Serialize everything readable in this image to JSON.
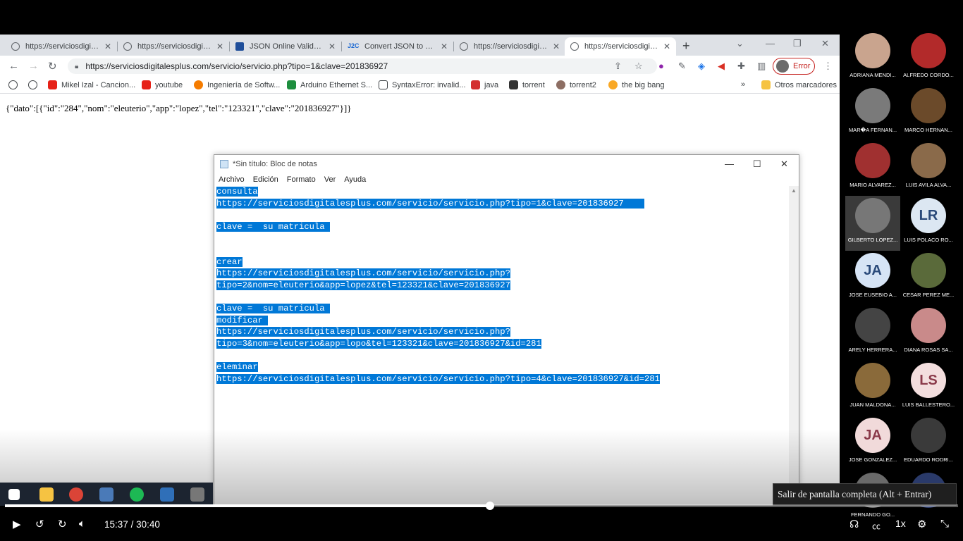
{
  "browser": {
    "tabs": [
      {
        "label": "https://serviciosdigitales",
        "icon": "globe-icon"
      },
      {
        "label": "https://serviciosdigitales",
        "icon": "globe-icon"
      },
      {
        "label": "JSON Online Validator",
        "icon": "jsonlint-icon"
      },
      {
        "label": "Convert JSON to C# Classes",
        "icon": "j2c-icon"
      },
      {
        "label": "https://serviciosdigitales",
        "icon": "globe-icon"
      },
      {
        "label": "https://serviciosdigitales",
        "icon": "globe-icon"
      }
    ],
    "url": "https://serviciosdigitalesplus.com/servicio/servicio.php?tipo=1&clave=201836927",
    "error_label": "Error",
    "bookmarks": [
      "Mikel Izal - Cancion...",
      "youtube",
      "Ingeniería de Softw...",
      "Arduino Ethernet S...",
      "SyntaxError: invalid...",
      "java",
      "torrent",
      "torrent2",
      "the big bang"
    ],
    "other_bookmarks": "Otros marcadores",
    "page_json": "{\"dato\":[{\"id\":\"284\",\"nom\":\"eleuterio\",\"app\":\"lopez\",\"tel\":\"123321\",\"clave\":\"201836927\"}]}"
  },
  "notepad": {
    "title": "*Sin título: Bloc de notas",
    "menu": [
      "Archivo",
      "Edición",
      "Formato",
      "Ver",
      "Ayuda"
    ],
    "lines": [
      "consulta",
      "https://serviciosdigitalesplus.com/servicio/servicio.php?tipo=1&clave=201836927    ",
      "",
      "clave =  su matricula ",
      "",
      "",
      "crear",
      "https://serviciosdigitalesplus.com/servicio/servicio.php?",
      "tipo=2&nom=eleuterio&app=lopez&tel=123321&clave=201836927",
      "",
      "clave =  su matricula ",
      "modificar ",
      "https://serviciosdigitalesplus.com/servicio/servicio.php?",
      "tipo=3&nom=eleuterio&app=lopo&tel=123321&clave=201836927&id=281",
      "",
      "eleminar",
      "https://serviciosdigitalesplus.com/servicio/servicio.php?tipo=4&clave=201836927&id=281"
    ]
  },
  "participants": [
    {
      "name": "ADRIANA MENDI...",
      "initials": "",
      "color": "#c9a48e"
    },
    {
      "name": "ALFREDO CORDO...",
      "initials": "",
      "color": "#b22a2a"
    },
    {
      "name": "MAR�A FERNAN...",
      "initials": "",
      "color": "#7a7a7a"
    },
    {
      "name": "MARCO HERNAN...",
      "initials": "",
      "color": "#6b4a2a"
    },
    {
      "name": "MARIO ALVAREZ...",
      "initials": "",
      "color": "#a03030"
    },
    {
      "name": "LUIS AVILA ALVA...",
      "initials": "",
      "color": "#8a6a4a"
    },
    {
      "name": "GILBERTO LOPEZ...",
      "initials": "",
      "color": "#777777"
    },
    {
      "name": "LUIS POLACO RO...",
      "initials": "LR",
      "color": "#dce7f2"
    },
    {
      "name": "JOSE EUSEBIO A...",
      "initials": "JA",
      "color": "#d6e4f5"
    },
    {
      "name": "CESAR PEREZ ME...",
      "initials": "",
      "color": "#5a6a3a"
    },
    {
      "name": "ARELY HERRERA...",
      "initials": "",
      "color": "#444444"
    },
    {
      "name": "DIANA ROSAS SA...",
      "initials": "",
      "color": "#c98a8a"
    },
    {
      "name": "JUAN MALDONA...",
      "initials": "",
      "color": "#8a6a3a"
    },
    {
      "name": "LUIS BALLESTERO...",
      "initials": "LS",
      "color": "#f3dede"
    },
    {
      "name": "JOSE GONZALEZ...",
      "initials": "JA",
      "color": "#f1dada"
    },
    {
      "name": "EDUARDO RODRI...",
      "initials": "",
      "color": "#3a3a3a"
    },
    {
      "name": "FERNANDO GO...",
      "initials": "",
      "color": "#6a6a6a"
    },
    {
      "name": "",
      "initials": "",
      "color": "#2a3a6a"
    }
  ],
  "player": {
    "tooltip": "Salir de pantalla completa (Alt + Entrar)",
    "current_time": "15:37",
    "separator": "/",
    "duration": "30:40",
    "speed": "1x",
    "progress_fraction": 0.509
  }
}
